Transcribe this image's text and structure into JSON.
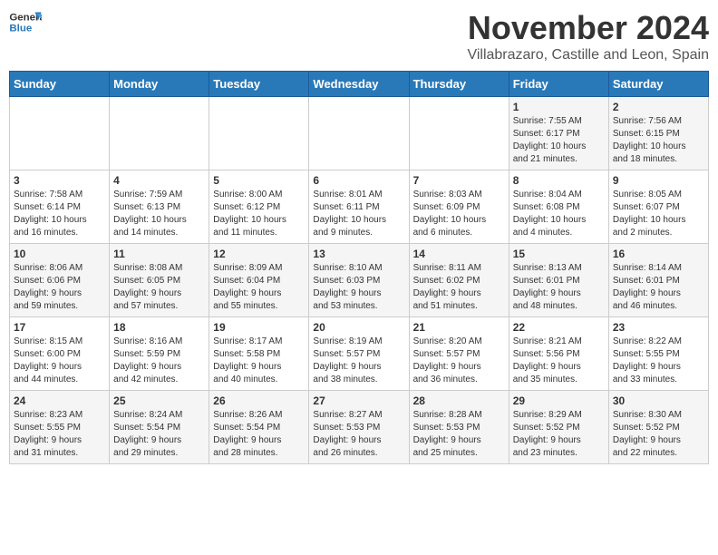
{
  "logo": {
    "line1": "General",
    "line2": "Blue"
  },
  "title": "November 2024",
  "subtitle": "Villabrazaro, Castille and Leon, Spain",
  "header_days": [
    "Sunday",
    "Monday",
    "Tuesday",
    "Wednesday",
    "Thursday",
    "Friday",
    "Saturday"
  ],
  "weeks": [
    [
      {
        "day": "",
        "info": ""
      },
      {
        "day": "",
        "info": ""
      },
      {
        "day": "",
        "info": ""
      },
      {
        "day": "",
        "info": ""
      },
      {
        "day": "",
        "info": ""
      },
      {
        "day": "1",
        "info": "Sunrise: 7:55 AM\nSunset: 6:17 PM\nDaylight: 10 hours\nand 21 minutes."
      },
      {
        "day": "2",
        "info": "Sunrise: 7:56 AM\nSunset: 6:15 PM\nDaylight: 10 hours\nand 18 minutes."
      }
    ],
    [
      {
        "day": "3",
        "info": "Sunrise: 7:58 AM\nSunset: 6:14 PM\nDaylight: 10 hours\nand 16 minutes."
      },
      {
        "day": "4",
        "info": "Sunrise: 7:59 AM\nSunset: 6:13 PM\nDaylight: 10 hours\nand 14 minutes."
      },
      {
        "day": "5",
        "info": "Sunrise: 8:00 AM\nSunset: 6:12 PM\nDaylight: 10 hours\nand 11 minutes."
      },
      {
        "day": "6",
        "info": "Sunrise: 8:01 AM\nSunset: 6:11 PM\nDaylight: 10 hours\nand 9 minutes."
      },
      {
        "day": "7",
        "info": "Sunrise: 8:03 AM\nSunset: 6:09 PM\nDaylight: 10 hours\nand 6 minutes."
      },
      {
        "day": "8",
        "info": "Sunrise: 8:04 AM\nSunset: 6:08 PM\nDaylight: 10 hours\nand 4 minutes."
      },
      {
        "day": "9",
        "info": "Sunrise: 8:05 AM\nSunset: 6:07 PM\nDaylight: 10 hours\nand 2 minutes."
      }
    ],
    [
      {
        "day": "10",
        "info": "Sunrise: 8:06 AM\nSunset: 6:06 PM\nDaylight: 9 hours\nand 59 minutes."
      },
      {
        "day": "11",
        "info": "Sunrise: 8:08 AM\nSunset: 6:05 PM\nDaylight: 9 hours\nand 57 minutes."
      },
      {
        "day": "12",
        "info": "Sunrise: 8:09 AM\nSunset: 6:04 PM\nDaylight: 9 hours\nand 55 minutes."
      },
      {
        "day": "13",
        "info": "Sunrise: 8:10 AM\nSunset: 6:03 PM\nDaylight: 9 hours\nand 53 minutes."
      },
      {
        "day": "14",
        "info": "Sunrise: 8:11 AM\nSunset: 6:02 PM\nDaylight: 9 hours\nand 51 minutes."
      },
      {
        "day": "15",
        "info": "Sunrise: 8:13 AM\nSunset: 6:01 PM\nDaylight: 9 hours\nand 48 minutes."
      },
      {
        "day": "16",
        "info": "Sunrise: 8:14 AM\nSunset: 6:01 PM\nDaylight: 9 hours\nand 46 minutes."
      }
    ],
    [
      {
        "day": "17",
        "info": "Sunrise: 8:15 AM\nSunset: 6:00 PM\nDaylight: 9 hours\nand 44 minutes."
      },
      {
        "day": "18",
        "info": "Sunrise: 8:16 AM\nSunset: 5:59 PM\nDaylight: 9 hours\nand 42 minutes."
      },
      {
        "day": "19",
        "info": "Sunrise: 8:17 AM\nSunset: 5:58 PM\nDaylight: 9 hours\nand 40 minutes."
      },
      {
        "day": "20",
        "info": "Sunrise: 8:19 AM\nSunset: 5:57 PM\nDaylight: 9 hours\nand 38 minutes."
      },
      {
        "day": "21",
        "info": "Sunrise: 8:20 AM\nSunset: 5:57 PM\nDaylight: 9 hours\nand 36 minutes."
      },
      {
        "day": "22",
        "info": "Sunrise: 8:21 AM\nSunset: 5:56 PM\nDaylight: 9 hours\nand 35 minutes."
      },
      {
        "day": "23",
        "info": "Sunrise: 8:22 AM\nSunset: 5:55 PM\nDaylight: 9 hours\nand 33 minutes."
      }
    ],
    [
      {
        "day": "24",
        "info": "Sunrise: 8:23 AM\nSunset: 5:55 PM\nDaylight: 9 hours\nand 31 minutes."
      },
      {
        "day": "25",
        "info": "Sunrise: 8:24 AM\nSunset: 5:54 PM\nDaylight: 9 hours\nand 29 minutes."
      },
      {
        "day": "26",
        "info": "Sunrise: 8:26 AM\nSunset: 5:54 PM\nDaylight: 9 hours\nand 28 minutes."
      },
      {
        "day": "27",
        "info": "Sunrise: 8:27 AM\nSunset: 5:53 PM\nDaylight: 9 hours\nand 26 minutes."
      },
      {
        "day": "28",
        "info": "Sunrise: 8:28 AM\nSunset: 5:53 PM\nDaylight: 9 hours\nand 25 minutes."
      },
      {
        "day": "29",
        "info": "Sunrise: 8:29 AM\nSunset: 5:52 PM\nDaylight: 9 hours\nand 23 minutes."
      },
      {
        "day": "30",
        "info": "Sunrise: 8:30 AM\nSunset: 5:52 PM\nDaylight: 9 hours\nand 22 minutes."
      }
    ]
  ]
}
